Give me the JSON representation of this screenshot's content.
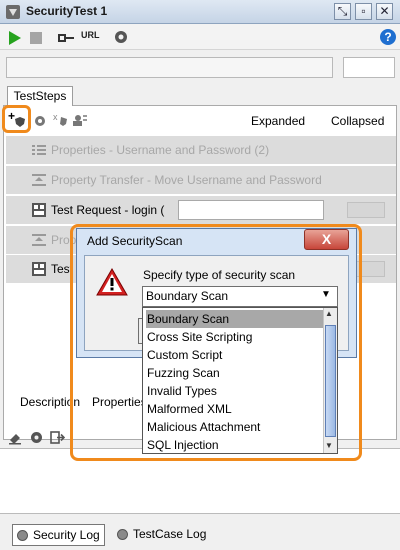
{
  "window": {
    "title": "SecurityTest 1"
  },
  "toolbar": {
    "url_label": "URL"
  },
  "tabs": {
    "teststeps": "TestSteps"
  },
  "step_toolbar": {
    "expanded": "Expanded",
    "collapsed": "Collapsed",
    "add_label": "+"
  },
  "steps": [
    {
      "label": "Properties - Username and Password (2)",
      "dim": true
    },
    {
      "label": "Property Transfer - Move Username and Password",
      "dim": true
    },
    {
      "label": "Test Request - login (",
      "dim": false
    },
    {
      "label": "Prope",
      "dim": true
    },
    {
      "label": "Test",
      "dim": false
    }
  ],
  "bottom_tabs": {
    "description": "Description",
    "properties": "Properties"
  },
  "log_tabs": {
    "security_log": "Security Log",
    "testcase_log": "TestCase Log"
  },
  "dialog": {
    "title": "Add SecurityScan",
    "close": "X",
    "prompt": "Specify type of security scan",
    "selected": "Boundary Scan",
    "options": [
      "Boundary Scan",
      "Cross Site Scripting",
      "Custom Script",
      "Fuzzing Scan",
      "Invalid Types",
      "Malformed XML",
      "Malicious Attachment",
      "SQL Injection"
    ]
  },
  "colors": {
    "highlight": "#f08a1c",
    "selected_option": "#a8a8a8",
    "help_icon": "#1f6fd0"
  }
}
